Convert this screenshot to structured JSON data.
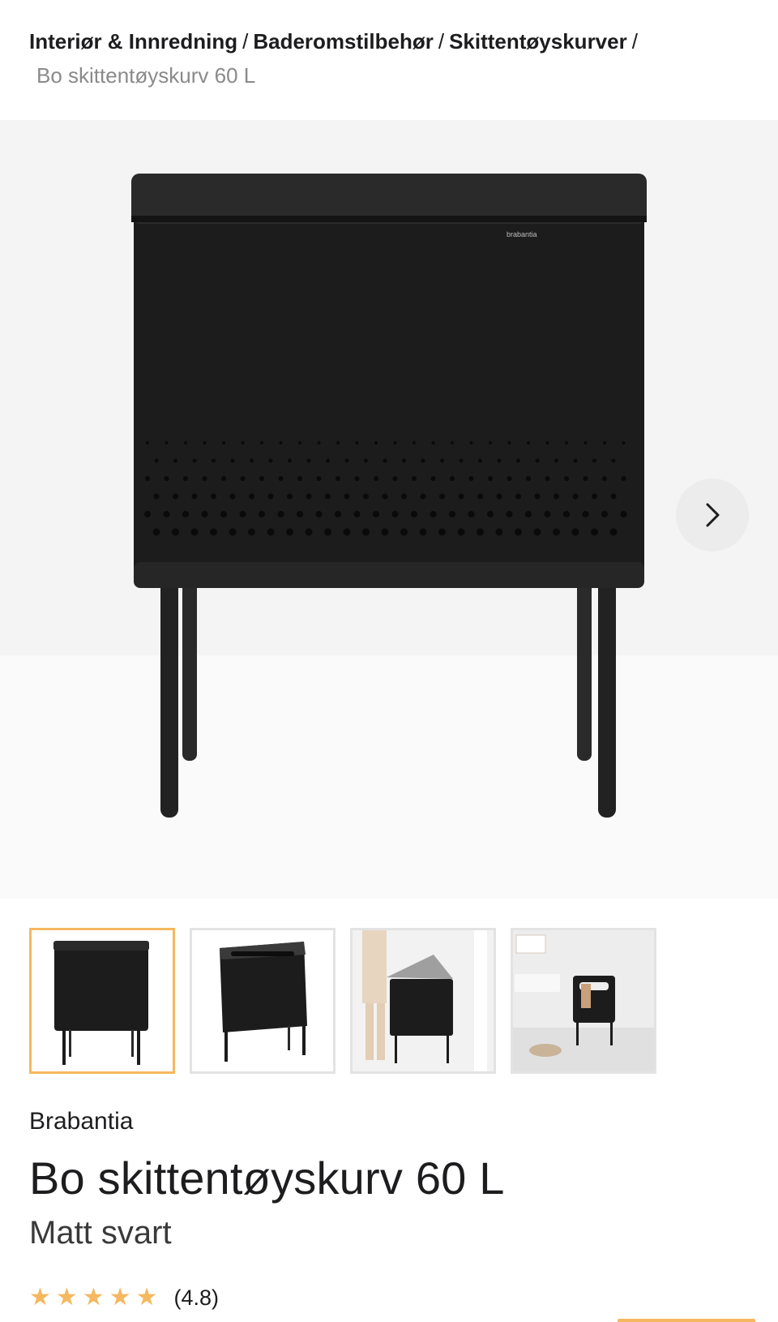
{
  "breadcrumb": {
    "items": [
      "Interiør & Innredning",
      "Baderomstilbehør",
      "Skittentøyskurver"
    ],
    "separator": "/",
    "current": "Bo skittentøyskurv 60 L"
  },
  "gallery": {
    "main_image_alt": "Bo skittentøyskurv 60 L",
    "product_logo_text": "brabantia",
    "next_icon": "chevron-right-icon",
    "thumbnails": [
      {
        "alt": "Bo skittentøyskurv 60 L front",
        "selected": true
      },
      {
        "alt": "Bo skittentøyskurv 60 L open top",
        "selected": false
      },
      {
        "alt": "Person removing laundry bag",
        "selected": false
      },
      {
        "alt": "Laundry basket in bathroom",
        "selected": false
      }
    ]
  },
  "product": {
    "brand": "Brabantia",
    "title": "Bo skittentøyskurv 60 L",
    "variant": "Matt svart",
    "rating": {
      "stars": 5,
      "value_text": "(4.8)",
      "value": 4.8
    }
  },
  "colors": {
    "accent": "#f5b860",
    "text": "#1d1d1f",
    "muted": "#8a8a8a",
    "product": "#1b1b1c"
  }
}
